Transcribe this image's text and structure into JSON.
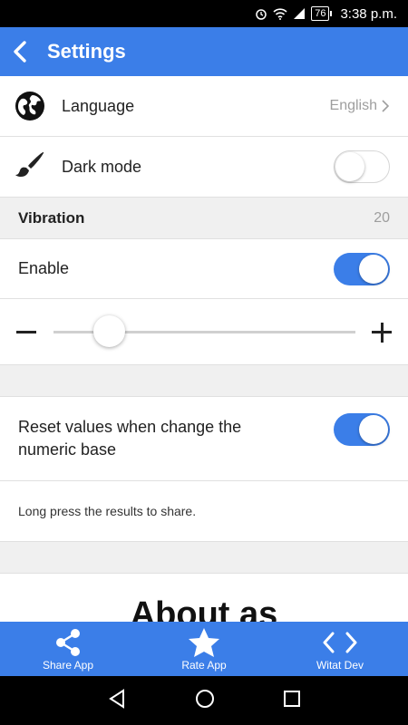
{
  "status_bar": {
    "battery": "76",
    "time": "3:38 p.m."
  },
  "app_bar": {
    "title": "Settings",
    "back_icon": "back-arrow-icon"
  },
  "settings": {
    "language": {
      "label": "Language",
      "value": "English",
      "icon": "globe-icon"
    },
    "dark_mode": {
      "label": "Dark mode",
      "icon": "paintbrush-icon",
      "enabled": false
    },
    "vibration": {
      "header": "Vibration",
      "value": "20"
    },
    "enable": {
      "label": "Enable",
      "enabled": true
    },
    "slider": {
      "value": 20,
      "min_icon": "minus-icon",
      "max_icon": "plus-icon"
    },
    "reset": {
      "label": "Reset values when change the numeric base",
      "enabled": true
    },
    "hint": "Long press the results to share.",
    "about_heading": "About as"
  },
  "bottom_nav": {
    "items": [
      {
        "label": "Share App",
        "icon": "share-icon"
      },
      {
        "label": "Rate App",
        "icon": "star-icon"
      },
      {
        "label": "Witat Dev",
        "icon": "code-icon"
      }
    ]
  },
  "colors": {
    "primary": "#3b7ee8",
    "divider": "#e0e0e0",
    "section_bg": "#f0f0f0"
  }
}
